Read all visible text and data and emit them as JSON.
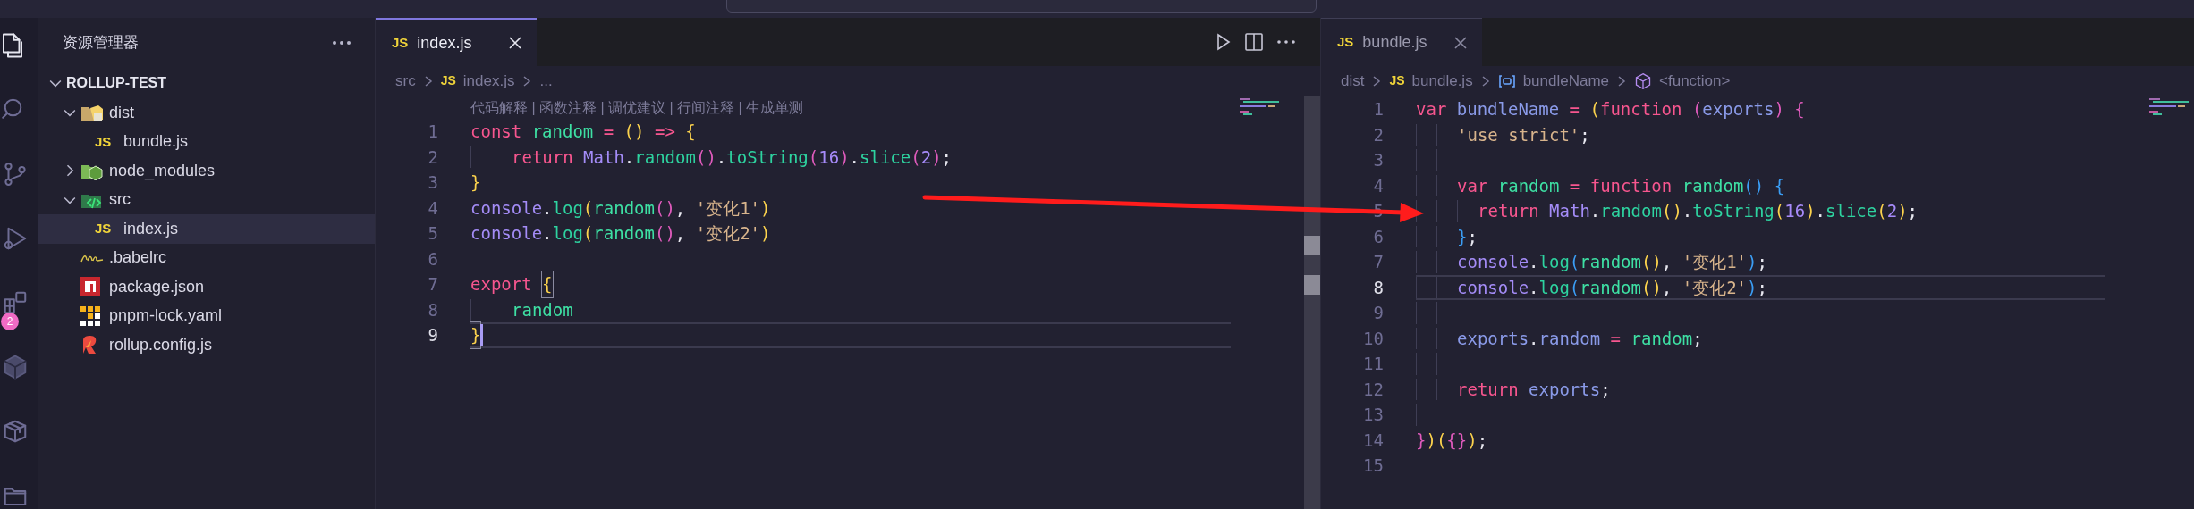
{
  "activity_bar": {
    "items": [
      {
        "kind": "files",
        "selected": true
      },
      {
        "kind": "search",
        "selected": false
      },
      {
        "kind": "source-control",
        "selected": false
      },
      {
        "kind": "run",
        "selected": false
      },
      {
        "kind": "extensions",
        "selected": false,
        "badge": "2"
      },
      {
        "kind": "hexagon",
        "selected": false
      },
      {
        "kind": "package",
        "selected": false
      },
      {
        "kind": "folder",
        "selected": false
      }
    ]
  },
  "sidebar": {
    "title": "资源管理器",
    "root": {
      "label": "ROLLUP-TEST",
      "expanded": true
    },
    "items": [
      {
        "label": "dist",
        "kind": "folder-dist",
        "expanded": true,
        "selected": false,
        "children": [
          {
            "label": "bundle.js",
            "kind": "js",
            "icon_text": "JS",
            "selected": false
          }
        ]
      },
      {
        "label": "node_modules",
        "kind": "folder-node",
        "expanded": false,
        "selected": false
      },
      {
        "label": "src",
        "kind": "folder-src",
        "expanded": true,
        "selected": false,
        "children": [
          {
            "label": "index.js",
            "kind": "js",
            "icon_text": "JS",
            "selected": true
          }
        ]
      },
      {
        "label": ".babelrc",
        "kind": "babel",
        "selected": false
      },
      {
        "label": "package.json",
        "kind": "npm",
        "selected": false
      },
      {
        "label": "pnpm-lock.yaml",
        "kind": "pnpm",
        "selected": false
      },
      {
        "label": "rollup.config.js",
        "kind": "rollup",
        "selected": false
      }
    ]
  },
  "editors": [
    {
      "tab": {
        "icon_text": "JS",
        "label": "index.js",
        "focused": true
      },
      "actions": [
        {
          "kind": "run"
        },
        {
          "kind": "split"
        },
        {
          "kind": "more"
        }
      ],
      "breadcrumb": [
        {
          "kind": "folder",
          "label": "src"
        },
        {
          "kind": "file",
          "icon_text": "JS",
          "label": "index.js"
        },
        {
          "kind": "more",
          "label": "..."
        }
      ],
      "codelens": "代码解释 | 函数注释 | 调优建议 | 行间注释 | 生成单测",
      "lines": [
        {
          "number": "1",
          "current": false,
          "words": [
            {
              "tokens": [
                {
                  "kind": "kw",
                  "text": "const"
                }
              ]
            },
            {
              "tokens": [
                {
                  "kind": "var",
                  "text": "random"
                }
              ]
            },
            {
              "tokens": [
                {
                  "kind": "op",
                  "text": "="
                }
              ]
            },
            {
              "tokens": [
                {
                  "kind": "b1",
                  "text": "()"
                }
              ]
            },
            {
              "tokens": [
                {
                  "kind": "op",
                  "text": "=>"
                }
              ]
            },
            {
              "tokens": [
                {
                  "kind": "b1",
                  "text": "{"
                }
              ]
            }
          ]
        },
        {
          "number": "2",
          "current": false,
          "guides": [
            {
              "kind": "guide4"
            }
          ],
          "words": [
            {
              "tokens": [
                {
                  "kind": "kw",
                  "text": "return"
                }
              ]
            },
            {
              "tokens": [
                {
                  "kind": "obj",
                  "text": "Math"
                },
                {
                  "kind": "p",
                  "text": "."
                },
                {
                  "kind": "fn",
                  "text": "random"
                },
                {
                  "kind": "b2",
                  "text": "()"
                },
                {
                  "kind": "p",
                  "text": "."
                },
                {
                  "kind": "fn",
                  "text": "toString"
                },
                {
                  "kind": "b2",
                  "text": "("
                },
                {
                  "kind": "num",
                  "text": "16"
                },
                {
                  "kind": "b2",
                  "text": ")"
                },
                {
                  "kind": "p",
                  "text": "."
                },
                {
                  "kind": "fn",
                  "text": "slice"
                },
                {
                  "kind": "b2",
                  "text": "("
                },
                {
                  "kind": "num",
                  "text": "2"
                },
                {
                  "kind": "b2",
                  "text": ")"
                },
                {
                  "kind": "p",
                  "text": ";"
                }
              ]
            }
          ]
        },
        {
          "number": "3",
          "current": false,
          "words": [
            {
              "tokens": [
                {
                  "kind": "b1",
                  "text": "}"
                }
              ]
            }
          ]
        },
        {
          "number": "4",
          "current": false,
          "words": [
            {
              "tokens": [
                {
                  "kind": "obj",
                  "text": "console"
                },
                {
                  "kind": "p",
                  "text": "."
                },
                {
                  "kind": "fn",
                  "text": "log"
                },
                {
                  "kind": "b1",
                  "text": "("
                },
                {
                  "kind": "var",
                  "text": "random"
                },
                {
                  "kind": "b2",
                  "text": "()"
                },
                {
                  "kind": "p",
                  "text": ","
                }
              ]
            },
            {
              "tokens": [
                {
                  "kind": "str",
                  "text": "'变化1'"
                },
                {
                  "kind": "b1",
                  "text": ")"
                }
              ]
            }
          ]
        },
        {
          "number": "5",
          "current": false,
          "words": [
            {
              "tokens": [
                {
                  "kind": "obj",
                  "text": "console"
                },
                {
                  "kind": "p",
                  "text": "."
                },
                {
                  "kind": "fn",
                  "text": "log"
                },
                {
                  "kind": "b1",
                  "text": "("
                },
                {
                  "kind": "var",
                  "text": "random"
                },
                {
                  "kind": "b2",
                  "text": "()"
                },
                {
                  "kind": "p",
                  "text": ","
                }
              ]
            },
            {
              "tokens": [
                {
                  "kind": "str",
                  "text": "'变化2'"
                },
                {
                  "kind": "b1",
                  "text": ")"
                }
              ]
            }
          ]
        },
        {
          "number": "6",
          "current": false
        },
        {
          "number": "7",
          "current": false,
          "words": [
            {
              "tokens": [
                {
                  "kind": "kw",
                  "text": "export"
                }
              ]
            },
            {
              "tokens": [
                {
                  "kind": "b1",
                  "text": "{",
                  "boxed": true
                }
              ]
            }
          ]
        },
        {
          "number": "8",
          "current": false,
          "guides": [
            {
              "kind": "guide4"
            }
          ],
          "words": [
            {
              "tokens": [
                {
                  "kind": "var",
                  "text": "random"
                }
              ]
            }
          ]
        },
        {
          "number": "9",
          "current": true,
          "cursor": true,
          "words": [
            {
              "tokens": [
                {
                  "kind": "b1",
                  "text": "}",
                  "boxed": true
                }
              ]
            }
          ]
        }
      ]
    },
    {
      "tab": {
        "icon_text": "JS",
        "label": "bundle.js",
        "focused": false
      },
      "breadcrumb": [
        {
          "kind": "folder",
          "label": "dist"
        },
        {
          "kind": "file",
          "icon_text": "JS",
          "label": "bundle.js"
        },
        {
          "kind": "variable",
          "label": "bundleName"
        },
        {
          "kind": "function",
          "label": "<function>"
        }
      ],
      "lines": [
        {
          "number": "1",
          "current": false,
          "words": [
            {
              "tokens": [
                {
                  "kind": "kw",
                  "text": "var"
                }
              ]
            },
            {
              "tokens": [
                {
                  "kind": "name",
                  "text": "bundleName"
                }
              ]
            },
            {
              "tokens": [
                {
                  "kind": "op",
                  "text": "="
                }
              ]
            },
            {
              "tokens": [
                {
                  "kind": "b1",
                  "text": "("
                },
                {
                  "kind": "kw",
                  "text": "function"
                }
              ]
            },
            {
              "tokens": [
                {
                  "kind": "b2",
                  "text": "("
                },
                {
                  "kind": "name",
                  "text": "exports"
                },
                {
                  "kind": "b2",
                  "text": ")"
                }
              ]
            },
            {
              "tokens": [
                {
                  "kind": "b2",
                  "text": "{"
                }
              ]
            }
          ]
        },
        {
          "number": "2",
          "current": false,
          "guides": [
            {
              "kind": "guide2"
            },
            {
              "kind": "guide2"
            }
          ],
          "words": [
            {
              "tokens": [
                {
                  "kind": "str",
                  "text": "'use strict'"
                },
                {
                  "kind": "p",
                  "text": ";"
                }
              ]
            }
          ]
        },
        {
          "number": "3",
          "current": false,
          "guides": [
            {
              "kind": "guide2"
            },
            {
              "kind": "guide2"
            }
          ]
        },
        {
          "number": "4",
          "current": false,
          "guides": [
            {
              "kind": "guide2"
            },
            {
              "kind": "guide2"
            }
          ],
          "words": [
            {
              "tokens": [
                {
                  "kind": "kw",
                  "text": "var"
                }
              ]
            },
            {
              "tokens": [
                {
                  "kind": "var",
                  "text": "random"
                }
              ]
            },
            {
              "tokens": [
                {
                  "kind": "op",
                  "text": "="
                }
              ]
            },
            {
              "tokens": [
                {
                  "kind": "kw",
                  "text": "function"
                }
              ]
            },
            {
              "tokens": [
                {
                  "kind": "var",
                  "text": "random"
                },
                {
                  "kind": "b3",
                  "text": "()"
                }
              ]
            },
            {
              "tokens": [
                {
                  "kind": "b3",
                  "text": "{"
                }
              ]
            }
          ]
        },
        {
          "number": "5",
          "current": false,
          "guides": [
            {
              "kind": "guide2"
            },
            {
              "kind": "guide2"
            },
            {
              "kind": "guide2"
            }
          ],
          "words": [
            {
              "tokens": [
                {
                  "kind": "kw",
                  "text": "return"
                }
              ]
            },
            {
              "tokens": [
                {
                  "kind": "obj",
                  "text": "Math"
                },
                {
                  "kind": "p",
                  "text": "."
                },
                {
                  "kind": "fn",
                  "text": "random"
                },
                {
                  "kind": "b1",
                  "text": "()"
                },
                {
                  "kind": "p",
                  "text": "."
                },
                {
                  "kind": "fn",
                  "text": "toString"
                },
                {
                  "kind": "b1",
                  "text": "("
                },
                {
                  "kind": "num",
                  "text": "16"
                },
                {
                  "kind": "b1",
                  "text": ")"
                },
                {
                  "kind": "p",
                  "text": "."
                },
                {
                  "kind": "fn",
                  "text": "slice"
                },
                {
                  "kind": "b1",
                  "text": "("
                },
                {
                  "kind": "num",
                  "text": "2"
                },
                {
                  "kind": "b1",
                  "text": ")"
                },
                {
                  "kind": "p",
                  "text": ";"
                }
              ]
            }
          ]
        },
        {
          "number": "6",
          "current": false,
          "guides": [
            {
              "kind": "guide2"
            },
            {
              "kind": "guide2"
            }
          ],
          "words": [
            {
              "tokens": [
                {
                  "kind": "b3",
                  "text": "}"
                },
                {
                  "kind": "p",
                  "text": ";"
                }
              ]
            }
          ]
        },
        {
          "number": "7",
          "current": false,
          "guides": [
            {
              "kind": "guide2"
            },
            {
              "kind": "guide2"
            }
          ],
          "words": [
            {
              "tokens": [
                {
                  "kind": "obj",
                  "text": "console"
                },
                {
                  "kind": "p",
                  "text": "."
                },
                {
                  "kind": "fn",
                  "text": "log"
                },
                {
                  "kind": "b3",
                  "text": "("
                },
                {
                  "kind": "var",
                  "text": "random"
                },
                {
                  "kind": "b1",
                  "text": "()"
                },
                {
                  "kind": "p",
                  "text": ","
                }
              ]
            },
            {
              "tokens": [
                {
                  "kind": "str",
                  "text": "'变化1'"
                },
                {
                  "kind": "b3",
                  "text": ")"
                },
                {
                  "kind": "p",
                  "text": ";"
                }
              ]
            }
          ]
        },
        {
          "number": "8",
          "current": true,
          "guides": [
            {
              "kind": "guide2"
            },
            {
              "kind": "guide2"
            }
          ],
          "words": [
            {
              "tokens": [
                {
                  "kind": "obj",
                  "text": "console"
                },
                {
                  "kind": "p",
                  "text": "."
                },
                {
                  "kind": "fn",
                  "text": "log"
                },
                {
                  "kind": "b3",
                  "text": "("
                },
                {
                  "kind": "var",
                  "text": "random"
                },
                {
                  "kind": "b1",
                  "text": "()"
                },
                {
                  "kind": "p",
                  "text": ","
                }
              ]
            },
            {
              "tokens": [
                {
                  "kind": "str",
                  "text": "'变化2'"
                },
                {
                  "kind": "b3",
                  "text": ")"
                },
                {
                  "kind": "p",
                  "text": ";"
                }
              ]
            }
          ]
        },
        {
          "number": "9",
          "current": false,
          "guides": [
            {
              "kind": "guide2"
            },
            {
              "kind": "guide2"
            }
          ]
        },
        {
          "number": "10",
          "current": false,
          "guides": [
            {
              "kind": "guide2"
            },
            {
              "kind": "guide2"
            }
          ],
          "words": [
            {
              "tokens": [
                {
                  "kind": "name",
                  "text": "exports"
                },
                {
                  "kind": "p",
                  "text": "."
                },
                {
                  "kind": "name",
                  "text": "random"
                }
              ]
            },
            {
              "tokens": [
                {
                  "kind": "op",
                  "text": "="
                }
              ]
            },
            {
              "tokens": [
                {
                  "kind": "var",
                  "text": "random"
                },
                {
                  "kind": "p",
                  "text": ";"
                }
              ]
            }
          ]
        },
        {
          "number": "11",
          "current": false,
          "guides": [
            {
              "kind": "guide2"
            },
            {
              "kind": "guide2"
            }
          ]
        },
        {
          "number": "12",
          "current": false,
          "guides": [
            {
              "kind": "guide2"
            },
            {
              "kind": "guide2"
            }
          ],
          "words": [
            {
              "tokens": [
                {
                  "kind": "kw",
                  "text": "return"
                }
              ]
            },
            {
              "tokens": [
                {
                  "kind": "name",
                  "text": "exports"
                },
                {
                  "kind": "p",
                  "text": ";"
                }
              ]
            }
          ]
        },
        {
          "number": "13",
          "current": false,
          "guides": [
            {
              "kind": "guide2"
            }
          ]
        },
        {
          "number": "14",
          "current": false,
          "words": [
            {
              "tokens": [
                {
                  "kind": "b2",
                  "text": "}"
                },
                {
                  "kind": "b1",
                  "text": ")("
                },
                {
                  "kind": "b2",
                  "text": "{}"
                },
                {
                  "kind": "b1",
                  "text": ")"
                },
                {
                  "kind": "p",
                  "text": ";"
                }
              ]
            }
          ]
        },
        {
          "number": "15",
          "current": false
        }
      ]
    }
  ]
}
